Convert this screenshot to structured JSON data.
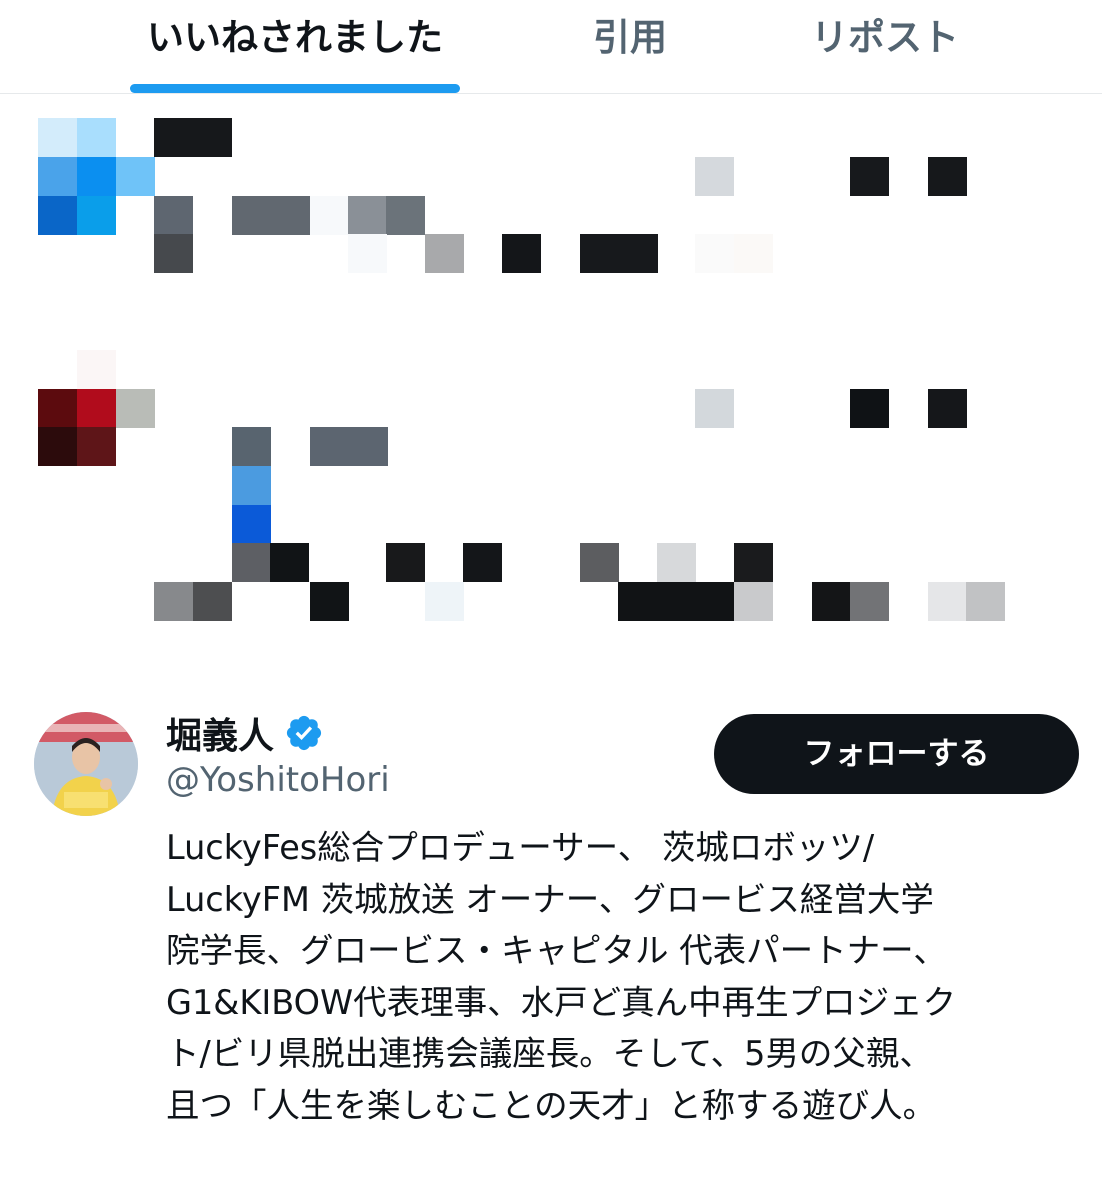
{
  "tabs": [
    {
      "label": "いいねされました",
      "active": true
    },
    {
      "label": "引用",
      "active": false
    },
    {
      "label": "リポスト",
      "active": false
    }
  ],
  "colors": {
    "accent": "#1d9bf0",
    "text_primary": "#0f1419",
    "text_secondary": "#536471",
    "button_bg": "#0f1419"
  },
  "profile": {
    "name": "堀義人",
    "verified_icon": "verified-badge-icon",
    "handle": "@YoshitoHori",
    "follow_label": "フォローする",
    "bio_lines": [
      "LuckyFes総合プロデューサー、 茨城ロボッツ/",
      "LuckyFM 茨城放送 オーナー、グロービス経営大学",
      "院学長、グロービス・キャピタル 代表パートナー、",
      "G1&KIBOW代表理事、水戸ど真ん中再生プロジェク",
      "ト/ビリ県脱出連携会議座長。そして、5男の父親、",
      "且つ「人生を楽しむことの天才」と称する遊び人。"
    ]
  }
}
